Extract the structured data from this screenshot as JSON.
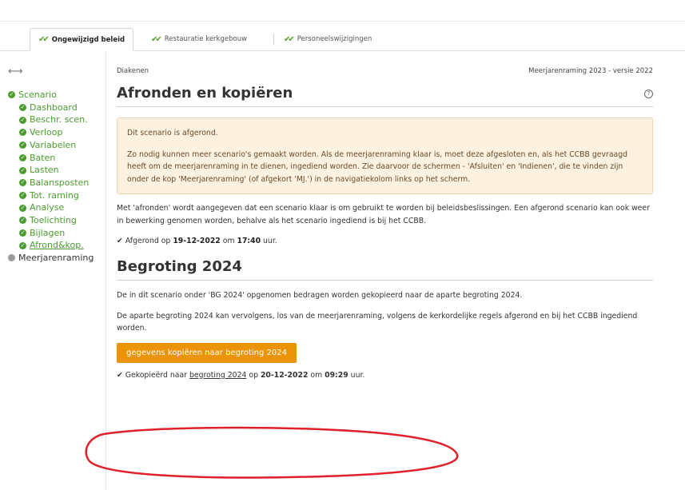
{
  "tabs": [
    {
      "label": "Ongewijzigd beleid",
      "active": true
    },
    {
      "label": "Restauratie kerkgebouw",
      "active": false
    },
    {
      "label": "Personeelswijzigingen",
      "active": false
    }
  ],
  "sidebar": {
    "items": [
      {
        "label": "Scenario",
        "level": 0,
        "state": "done"
      },
      {
        "label": "Dashboard",
        "level": 1,
        "state": "done"
      },
      {
        "label": "Beschr. scen.",
        "level": 1,
        "state": "done"
      },
      {
        "label": "Verloop",
        "level": 1,
        "state": "done"
      },
      {
        "label": "Variabelen",
        "level": 1,
        "state": "done"
      },
      {
        "label": "Baten",
        "level": 1,
        "state": "done"
      },
      {
        "label": "Lasten",
        "level": 1,
        "state": "done"
      },
      {
        "label": "Balansposten",
        "level": 1,
        "state": "done"
      },
      {
        "label": "Tot. raming",
        "level": 1,
        "state": "done"
      },
      {
        "label": "Analyse",
        "level": 1,
        "state": "done"
      },
      {
        "label": "Toelichting",
        "level": 1,
        "state": "done"
      },
      {
        "label": "Bijlagen",
        "level": 1,
        "state": "done"
      },
      {
        "label": "Afrond&kop.",
        "level": 1,
        "state": "current"
      },
      {
        "label": "Meerjarenraming",
        "level": 0,
        "state": "inactive"
      }
    ]
  },
  "header": {
    "org": "Diakenen",
    "version": "Meerjarenraming 2023 - versie 2022",
    "title": "Afronden en kopiëren",
    "help": "?"
  },
  "alert": {
    "line1": "Dit scenario is afgerond.",
    "line2": "Zo nodig kunnen meer scenario's gemaakt worden. Als de meerjarenraming klaar is, moet deze afgesloten en, als het CCBB gevraagd heeft om de meerjarenraming in te dienen, ingediend worden. Zie daarvoor de schermen - 'Afsluiten' en 'Indienen', die te vinden zijn onder de kop 'Meerjarenraming' (of afgekort 'MJ.') in de navigatiekolom links op het scherm."
  },
  "finalize": {
    "text": "Met 'afronden' wordt aangegeven dat een scenario klaar is om gebruikt te worden bij beleidsbeslissingen. Een afgerond scenario kan ook weer in bewerking genomen worden, behalve als het scenario ingediend is bij het CCBB.",
    "prefix": "Afgerond op",
    "date": "19-12-2022",
    "mid": "om",
    "time": "17:40",
    "suffix": "uur."
  },
  "budget": {
    "title": "Begroting 2024",
    "p1": "De in dit scenario onder 'BG 2024' opgenomen bedragen worden gekopieerd naar de aparte begroting 2024.",
    "p2": "De aparte begroting 2024 kan vervolgens, los van de meerjarenraming, volgens de kerkordelijke regels afgerond en bij het CCBB ingediend worden.",
    "button": "gegevens kopiëren naar begroting 2024",
    "copied_prefix": "Gekopieërd naar",
    "copied_link": "begroting 2024",
    "copied_mid1": "op",
    "copied_date": "20-12-2022",
    "copied_mid2": "om",
    "copied_time": "09:29",
    "copied_suffix": "uur."
  },
  "colors": {
    "accent_green": "#4b9d2f",
    "button_orange": "#ec9408",
    "alert_bg": "#fdf1df",
    "annotation_red": "#e0202a"
  }
}
